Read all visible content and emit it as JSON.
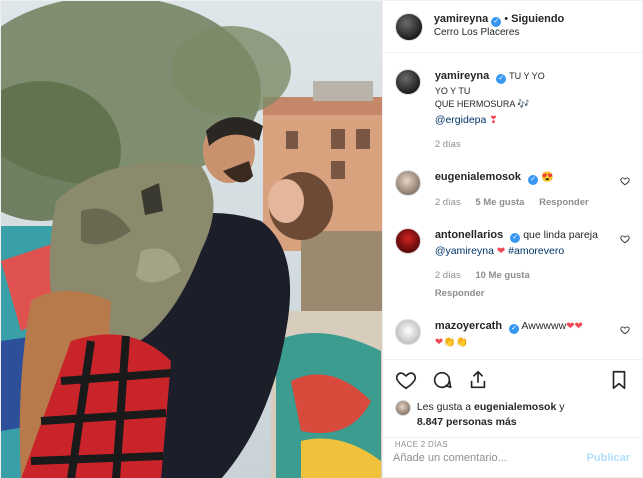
{
  "header": {
    "username": "yamireyna",
    "separator": "•",
    "follow_label": "Siguiendo",
    "location": "Cerro Los Placeres"
  },
  "caption": {
    "username": "yamireyna",
    "lines": [
      "TU Y YO",
      "YO Y TU",
      "QUE HERMOSURA"
    ],
    "mention": "@ergidepa",
    "time": "2 días"
  },
  "comments": [
    {
      "username": "eugenialemosok",
      "text": "",
      "emoji": "😍",
      "time": "2 días",
      "likes": "5 Me gusta",
      "reply": "Responder"
    },
    {
      "username": "antonellarios",
      "text": "que linda pareja",
      "mention": "@yamireyna",
      "hashtag": "#amorevero",
      "time": "2 días",
      "likes": "10 Me gusta",
      "reply": "Responder"
    },
    {
      "username": "mazoyercath",
      "text": "Awwwww"
    }
  ],
  "likes_summary": {
    "prefix": "Les gusta a",
    "user": "eugenialemosok",
    "connector": "y",
    "count": "8.847 personas más"
  },
  "posted_ago": "HACE 2 DÍAS",
  "add_comment": {
    "placeholder": "Añade un comentario...",
    "publish_label": "Publicar"
  },
  "colors": {
    "verified": "#3897f0",
    "link": "#003569",
    "muted": "#8e8e8e",
    "publish": "#b2dffc",
    "heart": "#ed4956"
  },
  "icons": [
    "heart-icon",
    "comment-icon",
    "share-icon",
    "bookmark-icon",
    "verified-badge-icon"
  ]
}
